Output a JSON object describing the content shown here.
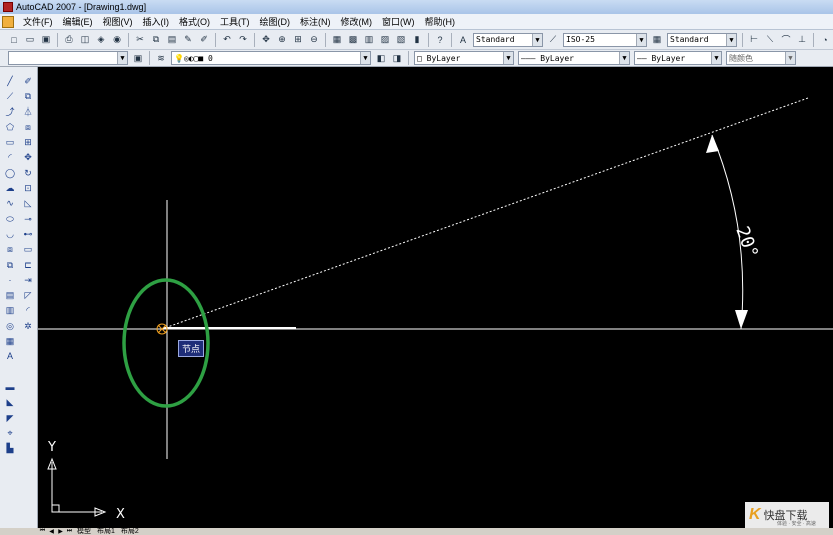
{
  "window": {
    "title": "AutoCAD 2007 - [Drawing1.dwg]"
  },
  "menu": {
    "items": [
      "文件(F)",
      "编辑(E)",
      "视图(V)",
      "插入(I)",
      "格式(O)",
      "工具(T)",
      "绘图(D)",
      "标注(N)",
      "修改(M)",
      "窗口(W)",
      "帮助(H)"
    ]
  },
  "styles_toolbar": {
    "text_style": "Standard",
    "dim_style": "ISO-25",
    "table_style": "Standard"
  },
  "properties_toolbar": {
    "layer": "0",
    "color": "ByLayer",
    "linetype": "ByLayer",
    "lineweight": "ByLayer",
    "plot_style": "随颜色"
  },
  "drawing": {
    "angle_label": "20°",
    "snap_tooltip": "节点",
    "ucs_x": "X",
    "ucs_y": "Y",
    "highlight_color": "#2ea043",
    "line_color": "#ffffff"
  },
  "layout_tabs": [
    "模型",
    "布局1",
    "布局2"
  ],
  "watermark": {
    "text": "快盘下载",
    "sub": "体验 · 安全 · 高速"
  }
}
